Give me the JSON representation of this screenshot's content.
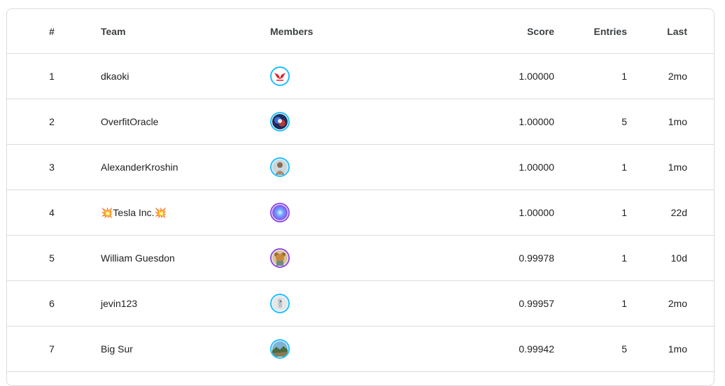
{
  "leaderboard": {
    "columns": {
      "rank": "#",
      "team": "Team",
      "members": "Members",
      "score": "Score",
      "entries": "Entries",
      "last": "Last"
    },
    "rows": [
      {
        "rank": "1",
        "team": "dkaoki",
        "score": "1.00000",
        "entries": "1",
        "last": "2mo",
        "avatar_icon": "red-wings-logo-avatar",
        "tier_color": "#20beff"
      },
      {
        "rank": "2",
        "team": "OverfitOracle",
        "score": "1.00000",
        "entries": "5",
        "last": "1mo",
        "avatar_icon": "colorful-photo-avatar",
        "tier_color": "#20beff"
      },
      {
        "rank": "3",
        "team": "AlexanderKroshin",
        "score": "1.00000",
        "entries": "1",
        "last": "1mo",
        "avatar_icon": "person-photo-avatar",
        "tier_color": "#20beff"
      },
      {
        "rank": "4",
        "team": "💥Tesla Inc.💥",
        "score": "1.00000",
        "entries": "1",
        "last": "22d",
        "avatar_icon": "blue-gradient-avatar",
        "tier_color": "#8d4ae0"
      },
      {
        "rank": "5",
        "team": "William Guesdon",
        "score": "0.99978",
        "entries": "1",
        "last": "10d",
        "avatar_icon": "cartoon-bear-avatar",
        "tier_color": "#8d4ae0"
      },
      {
        "rank": "6",
        "team": "jevin123",
        "score": "0.99957",
        "entries": "1",
        "last": "2mo",
        "avatar_icon": "grey-sketch-avatar",
        "tier_color": "#20beff"
      },
      {
        "rank": "7",
        "team": "Big Sur",
        "score": "0.99942",
        "entries": "5",
        "last": "1mo",
        "avatar_icon": "landscape-photo-avatar",
        "tier_color": "#20beff"
      }
    ]
  }
}
